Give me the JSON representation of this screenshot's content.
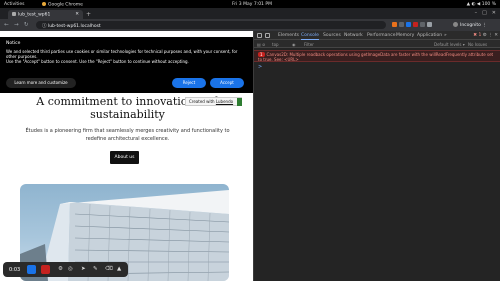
{
  "gnome_bar": {
    "activities": "Activities",
    "app_name": "Google Chrome",
    "clock": "Fri 3 May  7:01 PM",
    "battery": "100 %"
  },
  "browser": {
    "tab_title": "lub_test_wp61",
    "url": "lub-test-wp61.localhost",
    "profile_label": "Incognito"
  },
  "cookie_notice": {
    "title": "Notice",
    "text_line1": "We and selected third parties use cookies or similar technologies for technical purposes and, with your consent, for other purposes.",
    "text_line2": "Use the \"Accept\" button to consent. Use the \"Reject\" button to continue without accepting.",
    "learn_more": "Learn more and customize",
    "reject": "Reject",
    "accept": "Accept"
  },
  "hero": {
    "title": "A commitment to innovation and sustainability",
    "description": "Études is a pioneering firm that seamlessly merges creativity and functionality to redefine architectural excellence.",
    "cta": "About us"
  },
  "created_badge": {
    "prefix": "Created with ",
    "link": "Lubendo"
  },
  "recorder": {
    "time": "0:03"
  },
  "devtools": {
    "tabs": [
      "Elements",
      "Console",
      "Sources",
      "Network",
      "Performance",
      "Memory",
      "Application"
    ],
    "active_tab": "Console",
    "more": "»",
    "error_count": "1",
    "context": "top",
    "filter_placeholder": "Filter",
    "levels": "Default levels ▾",
    "issues": "No Issues",
    "error_badge": "1",
    "error_message": "Canvas2D: Multiple readback operations using getImageData are faster with the willReadFrequently attribute set to true. See: <URL>",
    "prompt": ">"
  },
  "colors": {
    "accent_blue": "#1a73e8",
    "error_red": "#c5221f",
    "devtools_bg": "#242424"
  }
}
